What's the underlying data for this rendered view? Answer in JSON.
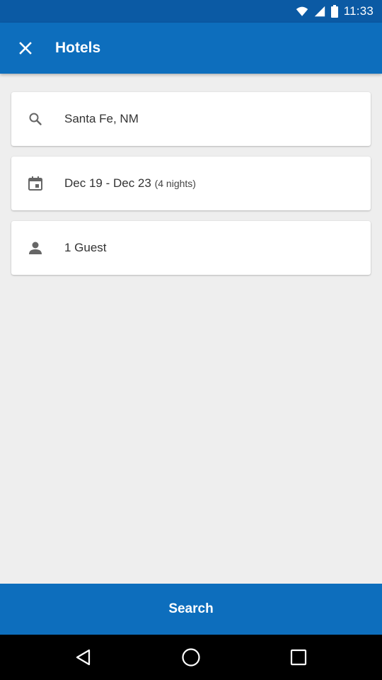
{
  "status_bar": {
    "time": "11:33"
  },
  "app_bar": {
    "title": "Hotels",
    "close_icon": "close-icon"
  },
  "fields": {
    "destination": {
      "icon": "search-icon",
      "value": "Santa Fe, NM"
    },
    "dates": {
      "icon": "calendar-icon",
      "value": "Dec 19 - Dec 23",
      "nights": "(4 nights)"
    },
    "guests": {
      "icon": "person-icon",
      "value": "1 Guest"
    }
  },
  "search_button": {
    "label": "Search"
  },
  "nav_bar": {
    "back_icon": "back-icon",
    "home_icon": "home-icon",
    "recents_icon": "recents-icon"
  },
  "colors": {
    "primary": "#0d6ebd",
    "status_bar": "#0b5aa4",
    "background": "#eeeeee"
  }
}
